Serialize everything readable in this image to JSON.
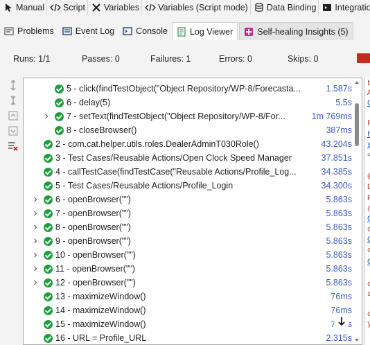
{
  "mode_tabs": [
    {
      "label": "Manual",
      "icon": "manual-cursor-icon"
    },
    {
      "label": "Script",
      "icon": "code-icon"
    },
    {
      "label": "Variables",
      "icon": "variables-icon"
    },
    {
      "label": "Variables (Script mode)",
      "icon": "code-icon"
    },
    {
      "label": "Data Binding",
      "icon": "database-icon"
    },
    {
      "label": "Integration",
      "icon": "integration-icon"
    }
  ],
  "view_tabs": [
    {
      "label": "Problems",
      "icon": "problems-icon"
    },
    {
      "label": "Event Log",
      "icon": "event-log-icon"
    },
    {
      "label": "Console",
      "icon": "console-icon"
    },
    {
      "label": "Log Viewer",
      "icon": "log-viewer-icon",
      "active": true
    },
    {
      "label": "Self-healing Insights (5)",
      "icon": "self-healing-icon"
    }
  ],
  "summary": {
    "runs": "Runs: 1/1",
    "passes": "Passes: 0",
    "failures": "Failures: 1",
    "errors": "Errors: 0",
    "skips": "Skips: 0",
    "status_color": "#c8281e"
  },
  "colors": {
    "pass": "#1e9e3e",
    "duration": "#3d5bc4",
    "fail_bar": "#c8281e"
  },
  "log_rows": [
    {
      "text": "5  - click(findTestObject(\"Object Repository/WP-8/Forecasta...",
      "duration": "1.587s",
      "indent": 2,
      "expandable": false
    },
    {
      "text": "6  - delay(5)",
      "duration": "5.5s",
      "indent": 2,
      "expandable": false
    },
    {
      "text": "7  - setText(findTestObject(\"Object Repository/WP-8/For...",
      "duration": "1m 769ms",
      "indent": 2,
      "expandable": true
    },
    {
      "text": "8  - closeBrowser()",
      "duration": "387ms",
      "indent": 2,
      "expandable": false
    },
    {
      "text": "2  - com.cat.helper.utils.roles.DealerAdminT030Role()",
      "duration": "43.204s",
      "indent": 1,
      "expandable": false
    },
    {
      "text": "3  - Test Cases/Reusable Actions/Open Clock Speed Manager",
      "duration": "37.851s",
      "indent": 1,
      "expandable": false
    },
    {
      "text": "4  - callTestCase(findTestCase(\"Reusable Actions/Profile_Log...",
      "duration": "34.385s",
      "indent": 1,
      "expandable": false
    },
    {
      "text": "5  - Test Cases/Reusable Actions/Profile_Login",
      "duration": "34.300s",
      "indent": 1,
      "expandable": false
    },
    {
      "text": "6  - openBrowser(\"\")",
      "duration": "5.863s",
      "indent": 1,
      "expandable": true
    },
    {
      "text": "7  - openBrowser(\"\")",
      "duration": "5.863s",
      "indent": 1,
      "expandable": true
    },
    {
      "text": "8  - openBrowser(\"\")",
      "duration": "5.863s",
      "indent": 1,
      "expandable": true
    },
    {
      "text": "9  - openBrowser(\"\")",
      "duration": "5.863s",
      "indent": 1,
      "expandable": true
    },
    {
      "text": "10  - openBrowser(\"\")",
      "duration": "5.863s",
      "indent": 1,
      "expandable": true
    },
    {
      "text": "11  - openBrowser(\"\")",
      "duration": "5.863s",
      "indent": 1,
      "expandable": true
    },
    {
      "text": "12  - openBrowser(\"\")",
      "duration": "5.863s",
      "indent": 1,
      "expandable": true
    },
    {
      "text": "13  - maximizeWindow()",
      "duration": "76ms",
      "indent": 1,
      "expandable": false
    },
    {
      "text": "14  - maximizeWindow()",
      "duration": "76ms",
      "indent": 1,
      "expandable": false
    },
    {
      "text": "15  - maximizeWindow()",
      "duration": "76ms",
      "indent": 1,
      "expandable": false
    },
    {
      "text": "16  - URL = Profile_URL",
      "duration": "2.315s",
      "indent": 1,
      "expandable": false
    }
  ],
  "right_console_glyphs": [
    {
      "ch": "b",
      "cls": "red"
    },
    {
      "ch": "A",
      "cls": "red"
    },
    {
      "ch": "C",
      "cls": "link"
    },
    {
      "ch": "F",
      "cls": "red"
    },
    {
      "ch": "h",
      "cls": "link"
    },
    {
      "ch": "s",
      "cls": "link"
    },
    {
      "ch": "=",
      "cls": "red"
    },
    {
      "ch": "0",
      "cls": "red"
    },
    {
      "ch": "D",
      "cls": "red"
    },
    {
      "ch": "R",
      "cls": "red"
    },
    {
      "ch": "c",
      "cls": "red"
    },
    {
      "ch": "C",
      "cls": "link"
    },
    {
      "ch": "c",
      "cls": "red"
    },
    {
      "ch": "C",
      "cls": "link"
    },
    {
      "ch": "c",
      "cls": "red"
    },
    {
      "ch": "C",
      "cls": "link"
    },
    {
      "ch": "c",
      "cls": "red"
    },
    {
      "ch": "a",
      "cls": "red"
    },
    {
      "ch": "c",
      "cls": "red"
    },
    {
      "ch": "y",
      "cls": "red"
    }
  ]
}
